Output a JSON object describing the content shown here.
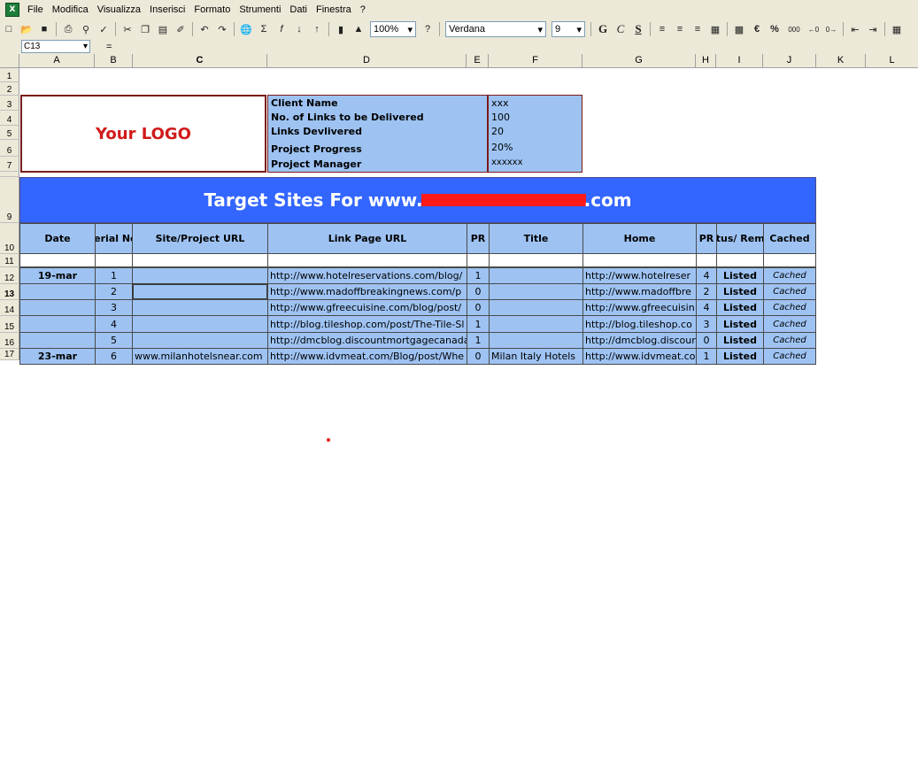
{
  "menu": [
    "File",
    "Modifica",
    "Visualizza",
    "Inserisci",
    "Formato",
    "Strumenti",
    "Dati",
    "Finestra",
    "?"
  ],
  "toolbar": {
    "zoom": "100%",
    "font_name": "Verdana",
    "font_size": "9",
    "bold": "G",
    "italic": "C",
    "underline": "S",
    "euro": "€",
    "percent": "%",
    "thousands": "000"
  },
  "formula_bar": {
    "cell_ref": "C13",
    "equals": "="
  },
  "columns": [
    "A",
    "B",
    "C",
    "D",
    "E",
    "F",
    "G",
    "H",
    "I",
    "J",
    "K",
    "L"
  ],
  "rows": [
    "1",
    "2",
    "3",
    "4",
    "5",
    "6",
    "7",
    "9",
    "10",
    "11",
    "12",
    "13",
    "14",
    "15",
    "16",
    "17"
  ],
  "logo": {
    "text": "Your LOGO"
  },
  "info": [
    {
      "label": "Client Name",
      "value": "xxx"
    },
    {
      "label": "No. of Links to be Delivered",
      "value": "100"
    },
    {
      "label": "Links Devlivered",
      "value": "20"
    },
    {
      "label": "Project Progress",
      "value": "20%"
    },
    {
      "label": "Project Manager",
      "value": "xxxxxx"
    }
  ],
  "banner": {
    "prefix": "Target Sites For www.",
    "suffix": ".com"
  },
  "table": {
    "headers": [
      "Date",
      "Serial No.",
      "Site/Project URL",
      "Link Page URL",
      "PR",
      "Title",
      "Home",
      "PR",
      "Status/ Remark",
      "Cached"
    ],
    "rows": [
      [
        "19-mar",
        "1",
        "",
        "http://www.hotelreservations.com/blog/",
        "1",
        "",
        "http://www.hotelreser",
        "4",
        "Listed",
        "Cached"
      ],
      [
        "",
        "2",
        "",
        "http://www.madoffbreakingnews.com/p",
        "0",
        "",
        "http://www.madoffbre",
        "2",
        "Listed",
        "Cached"
      ],
      [
        "",
        "3",
        "",
        "http://www.gfreecuisine.com/blog/post/",
        "0",
        "",
        "http://www.gfreecuisin",
        "4",
        "Listed",
        "Cached"
      ],
      [
        "",
        "4",
        "",
        "http://blog.tileshop.com/post/The-Tile-Sl",
        "1",
        "",
        "http://blog.tileshop.co",
        "3",
        "Listed",
        "Cached"
      ],
      [
        "",
        "5",
        "",
        "http://dmcblog.discountmortgagecanada",
        "1",
        "",
        "http://dmcblog.discour",
        "0",
        "Listed",
        "Cached"
      ],
      [
        "23-mar",
        "6",
        "www.milanhotelsnear.com",
        "http://www.idvmeat.com/Blog/post/Whe",
        "0",
        "Milan Italy Hotels",
        "http://www.idvmeat.co",
        "1",
        "Listed",
        "Cached"
      ]
    ]
  }
}
